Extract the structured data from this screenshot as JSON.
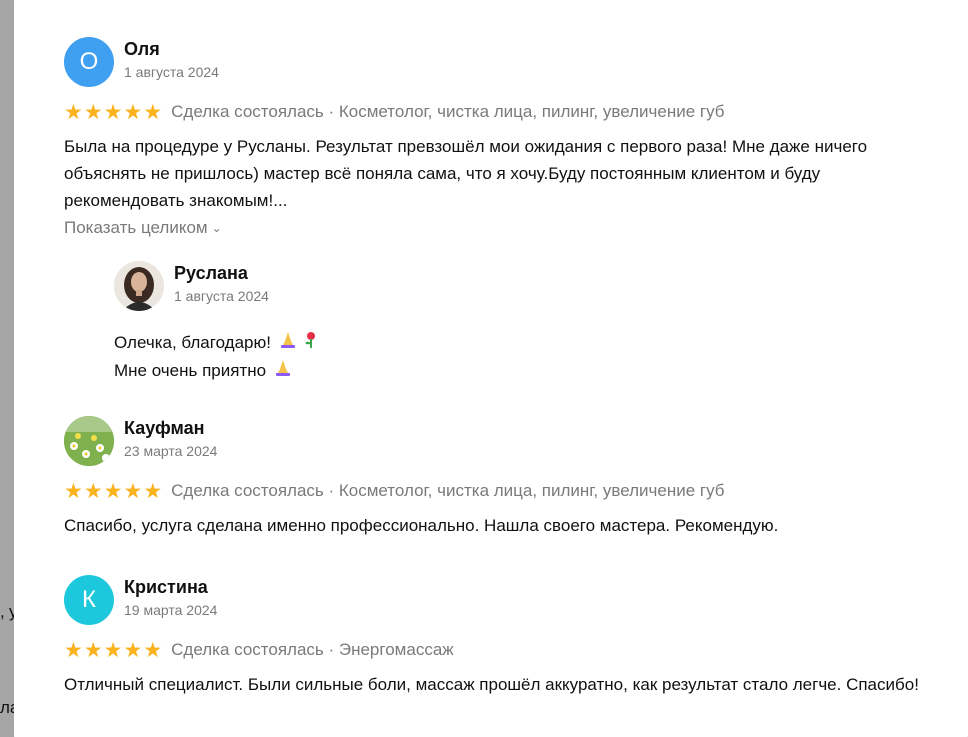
{
  "background_fragments": [
    ",",
    "у",
    "ла"
  ],
  "reviews": [
    {
      "initial": "О",
      "avatar_color": "#3f9ff0",
      "name": "Оля",
      "date": "1 августа 2024",
      "rating": 5,
      "meta": "Сделка состоялась · Косметолог, чистка лица, пилинг, увеличение губ",
      "text": "Была на процедуре у Русланы. Результат превзошёл мои ожидания с первого раза! Мне даже ничего объяснять не пришлось) мастер всё поняла сама, что я хочу.Буду постоянным клиентом и буду рекомендовать знакомым!...",
      "show_more": "Показать целиком",
      "reply": {
        "name": "Руслана",
        "date": "1 августа 2024",
        "line1": "Олечка, благодарю!",
        "line2": "Мне очень приятно"
      }
    },
    {
      "name": "Кауфман",
      "date": "23 марта 2024",
      "rating": 5,
      "meta": "Сделка состоялась · Косметолог, чистка лица, пилинг, увеличение губ",
      "text": "Спасибо, услуга сделана именно профессионально. Нашла своего мастера. Рекомендую."
    },
    {
      "initial": "К",
      "avatar_color": "#1ec8dc",
      "name": "Кристина",
      "date": "19 марта 2024",
      "rating": 5,
      "meta": "Сделка состоялась · Энергомассаж",
      "text": "Отличный специалист. Были сильные боли, массаж прошёл аккуратно, как результат стало легче. Спасибо!"
    }
  ],
  "colors": {
    "star": "#fbb21f",
    "muted": "#7a7a7a",
    "text": "#111111"
  }
}
